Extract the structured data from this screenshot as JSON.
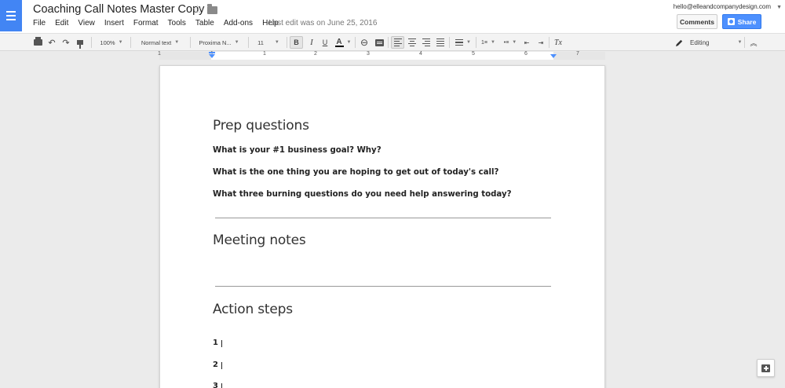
{
  "header": {
    "doc_title": "Coaching Call Notes Master Copy",
    "menu": [
      "File",
      "Edit",
      "View",
      "Insert",
      "Format",
      "Tools",
      "Table",
      "Add-ons",
      "Help"
    ],
    "last_edit": "Last edit was on June 25, 2016",
    "account_email": "hello@elleandcompanydesign.com",
    "comments_label": "Comments",
    "share_label": "Share"
  },
  "toolbar": {
    "zoom": "100%",
    "style": "Normal text",
    "font": "Proxima N...",
    "font_size": "11",
    "bold": "B",
    "italic": "I",
    "underline": "U",
    "text_color": "A",
    "clear_format": "Tx",
    "mode": "Editing"
  },
  "ruler": {
    "numbers": [
      "1",
      "1",
      "1",
      "2",
      "3",
      "4",
      "5",
      "6",
      "7"
    ]
  },
  "document": {
    "heading_prep": "Prep questions",
    "q1": "What is your #1 business goal? Why?",
    "q2": "What is the one thing you are hoping to get out of today's call?",
    "q3": "What three burning questions do you need help answering today?",
    "heading_meeting": "Meeting notes",
    "heading_action": "Action steps",
    "steps": [
      "1",
      "2",
      "3"
    ]
  },
  "colors": {
    "brand_blue": "#4285f4",
    "share_blue": "#4d90fe"
  }
}
